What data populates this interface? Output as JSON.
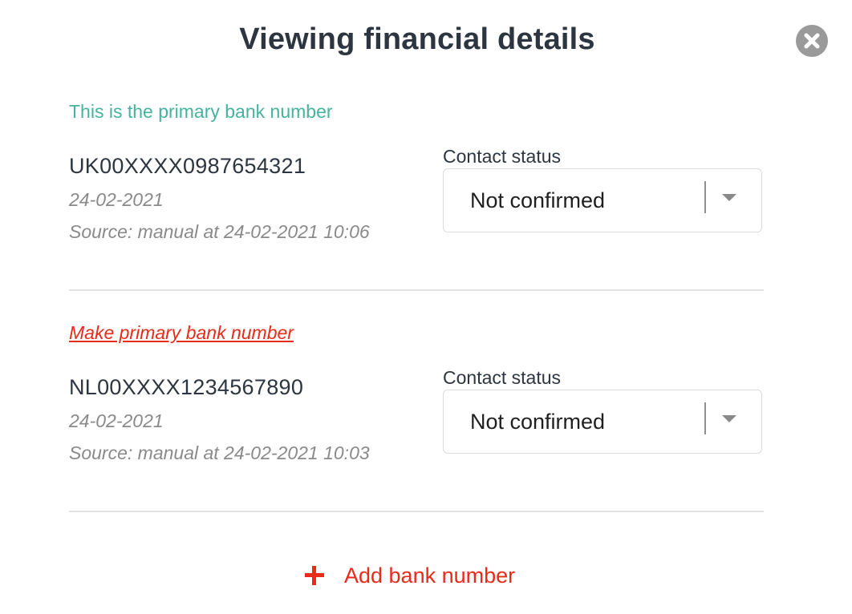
{
  "modal": {
    "title": "Viewing financial details"
  },
  "accounts": [
    {
      "primary_label": "This is the primary bank number",
      "number": "UK00XXXX0987654321",
      "date": "24-02-2021",
      "source": "Source: manual at 24-02-2021 10:06",
      "status_label": "Contact status",
      "status_value": "Not confirmed"
    },
    {
      "make_primary_label": "Make primary bank number",
      "number": "NL00XXXX1234567890",
      "date": "24-02-2021",
      "source": "Source: manual at 24-02-2021 10:03",
      "status_label": "Contact status",
      "status_value": "Not confirmed"
    }
  ],
  "add_bank": {
    "label": "Add bank number"
  },
  "icons": {
    "close": "close-icon",
    "dropdown": "chevron-down-icon",
    "add": "plus-icon"
  },
  "colors": {
    "primary_label": "#45b39d",
    "action_red": "#ea2a1b",
    "close_button": "#9a9a9a",
    "title": "#2d3640"
  }
}
